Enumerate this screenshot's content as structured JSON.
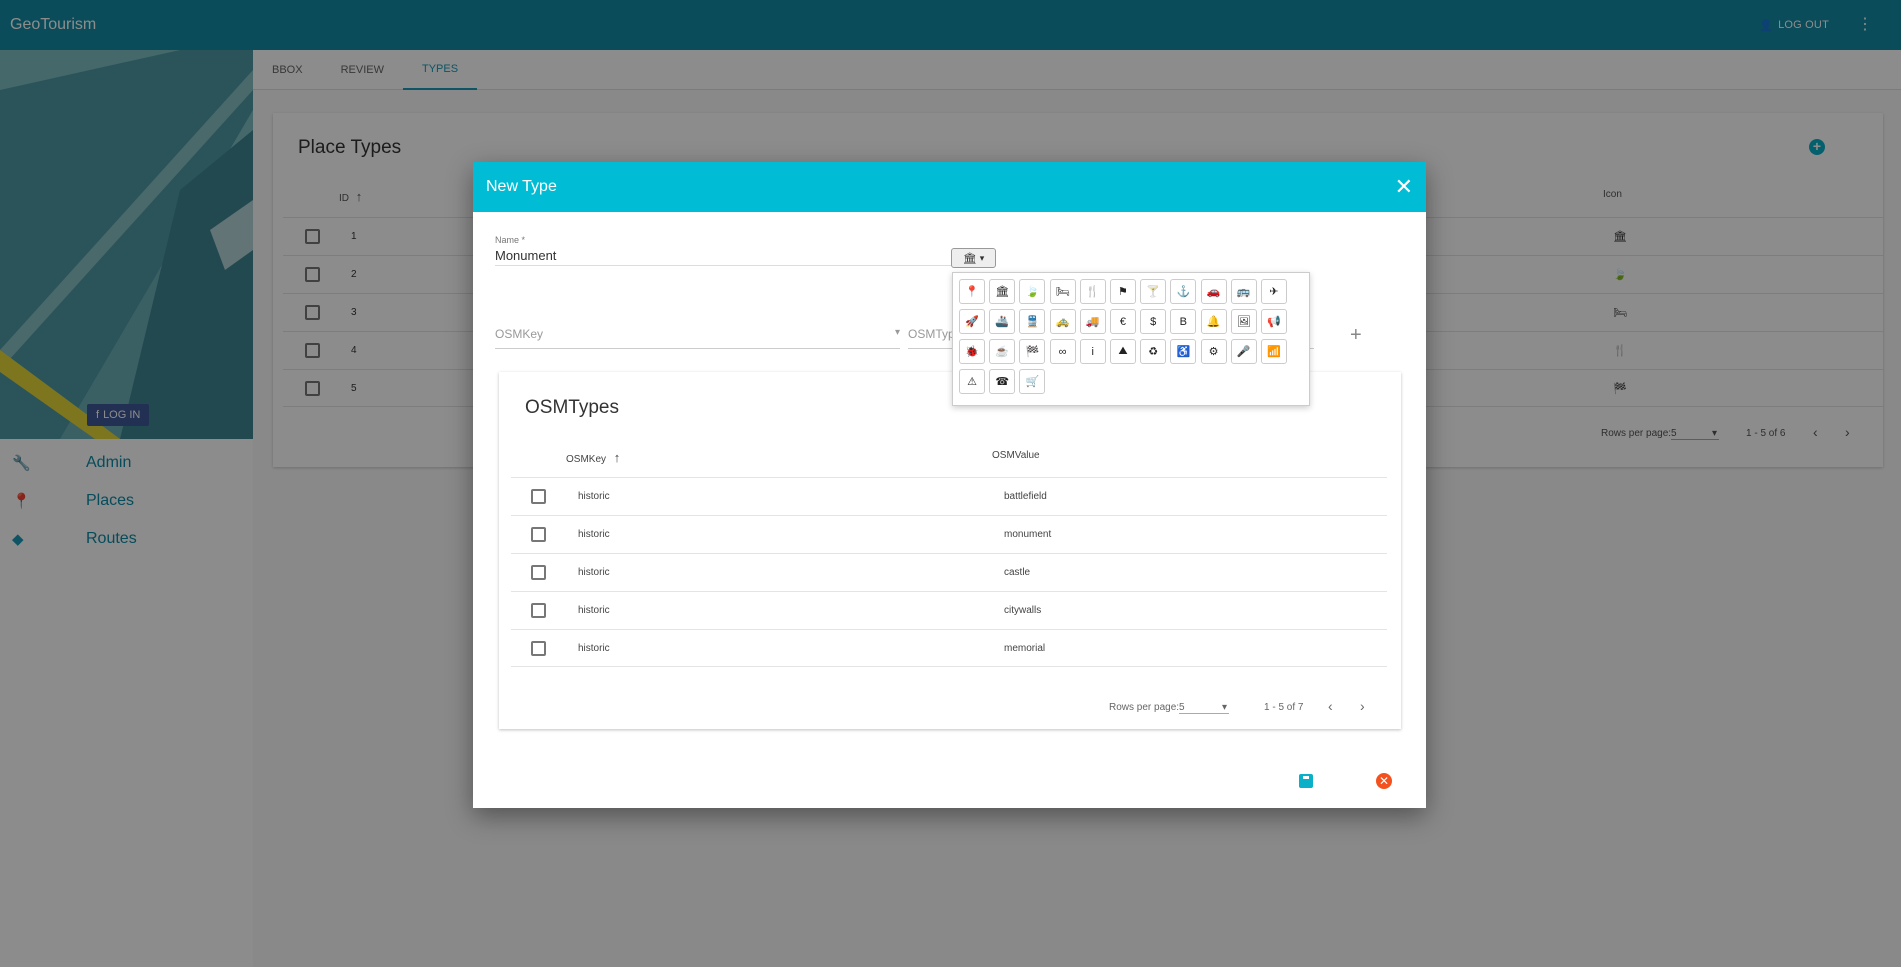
{
  "app": {
    "title": "GeoTourism",
    "logout_label": "LOG OUT"
  },
  "sidebar": {
    "login_label": "LOG IN",
    "items": [
      {
        "label": "Admin",
        "icon": "wrench-icon"
      },
      {
        "label": "Places",
        "icon": "map-marker-icon"
      },
      {
        "label": "Routes",
        "icon": "directions-icon"
      }
    ]
  },
  "tabs": [
    "BBOX",
    "REVIEW",
    "TYPES"
  ],
  "place_types": {
    "title": "Place Types",
    "col_id": "ID",
    "col_icon": "Icon",
    "rows": [
      {
        "id": "1",
        "icon": "🏛"
      },
      {
        "id": "2",
        "icon": "🍃"
      },
      {
        "id": "3",
        "icon": "🛏"
      },
      {
        "id": "4",
        "icon": "🍴"
      },
      {
        "id": "5",
        "icon": "🏁"
      }
    ],
    "rows_per_page_label": "Rows per page:",
    "rows_per_page": "5",
    "range": "1 - 5 of 6"
  },
  "dialog": {
    "title": "New Type",
    "name_label": "Name *",
    "name_value": "Monument",
    "osmkey_placeholder": "OSMKey",
    "osmtype_placeholder": "OSMTyp",
    "osm_table": {
      "title": "OSMTypes",
      "col_key": "OSMKey",
      "col_value": "OSMValue",
      "rows": [
        {
          "key": "historic",
          "value": "battlefield"
        },
        {
          "key": "historic",
          "value": "monument"
        },
        {
          "key": "historic",
          "value": "castle"
        },
        {
          "key": "historic",
          "value": "citywalls"
        },
        {
          "key": "historic",
          "value": "memorial"
        }
      ],
      "rows_per_page_label": "Rows per page:",
      "rows_per_page": "5",
      "range": "1 - 5 of 7"
    },
    "icon_picker": [
      {
        "name": "map-marker-icon",
        "glyph": "📍"
      },
      {
        "name": "bank-icon",
        "glyph": "🏛"
      },
      {
        "name": "leaf-icon",
        "glyph": "🍃"
      },
      {
        "name": "bed-icon",
        "glyph": "🛏"
      },
      {
        "name": "cutlery-icon",
        "glyph": "🍴"
      },
      {
        "name": "flag-icon",
        "glyph": "⚑"
      },
      {
        "name": "glass-icon",
        "glyph": "🍸"
      },
      {
        "name": "anchor-icon",
        "glyph": "⚓"
      },
      {
        "name": "car-icon",
        "glyph": "🚗"
      },
      {
        "name": "bus-icon",
        "glyph": "🚌"
      },
      {
        "name": "plane-icon",
        "glyph": "✈"
      },
      {
        "name": "rocket-icon",
        "glyph": "🚀"
      },
      {
        "name": "ship-icon",
        "glyph": "🚢"
      },
      {
        "name": "train-icon",
        "glyph": "🚆"
      },
      {
        "name": "taxi-icon",
        "glyph": "🚕"
      },
      {
        "name": "truck-icon",
        "glyph": "🚚"
      },
      {
        "name": "euro-icon",
        "glyph": "€"
      },
      {
        "name": "dollar-icon",
        "glyph": "$"
      },
      {
        "name": "bitcoin-icon",
        "glyph": "B"
      },
      {
        "name": "bell-icon",
        "glyph": "🔔"
      },
      {
        "name": "image-icon",
        "glyph": "🖼"
      },
      {
        "name": "bullhorn-icon",
        "glyph": "📢"
      },
      {
        "name": "bug-icon",
        "glyph": "🐞"
      },
      {
        "name": "coffee-icon",
        "glyph": "☕"
      },
      {
        "name": "flag-checkered-icon",
        "glyph": "🏁"
      },
      {
        "name": "mask-icon",
        "glyph": "∞"
      },
      {
        "name": "info-icon",
        "glyph": "i"
      },
      {
        "name": "road-icon",
        "glyph": "⛰"
      },
      {
        "name": "recycle-icon",
        "glyph": "♻"
      },
      {
        "name": "wheelchair-icon",
        "glyph": "♿"
      },
      {
        "name": "cogs-icon",
        "glyph": "⚙"
      },
      {
        "name": "microphone-icon",
        "glyph": "🎤"
      },
      {
        "name": "wifi-icon",
        "glyph": "📶"
      },
      {
        "name": "warning-icon",
        "glyph": "⚠"
      },
      {
        "name": "phone-icon",
        "glyph": "☎"
      },
      {
        "name": "shopping-cart-icon",
        "glyph": "🛒"
      }
    ],
    "selected_icon_glyph": "🏛"
  }
}
